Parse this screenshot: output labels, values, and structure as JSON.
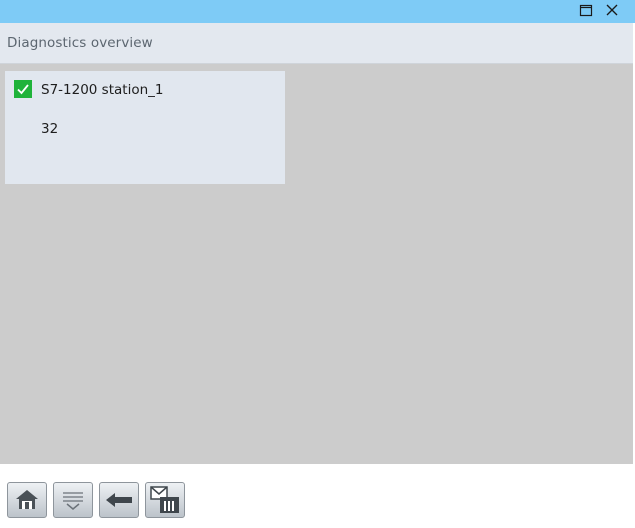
{
  "window": {
    "maximize_icon": "maximize-icon",
    "close_icon": "close-icon"
  },
  "header": {
    "title": "Diagnostics overview"
  },
  "stations": [
    {
      "name": "S7-1200 station_1",
      "value": "32",
      "status": "ok",
      "status_color": "#1fb33a"
    }
  ],
  "toolbar": {
    "buttons": [
      {
        "icon": "home-icon"
      },
      {
        "icon": "scroll-down-icon"
      },
      {
        "icon": "back-arrow-icon"
      },
      {
        "icon": "diagnostic-buffer-icon"
      }
    ]
  },
  "colors": {
    "titlebar": "#7ecbf6",
    "header": "#e3e8ef",
    "content_background": "#cccccc",
    "card": "#e1e7ef"
  }
}
